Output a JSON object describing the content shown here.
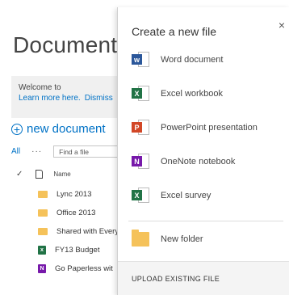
{
  "library": {
    "title": "Documents",
    "welcome_text": "Welcome to",
    "learn_more": "Learn more here.",
    "dismiss": "Dismiss",
    "new_document": "new document",
    "view_all": "All",
    "more": "···",
    "find_placeholder": "Find a file",
    "column_name": "Name",
    "rows": [
      {
        "name": "Lync 2013",
        "icon": "folder-icon"
      },
      {
        "name": "Office 2013",
        "icon": "folder-icon"
      },
      {
        "name": "Shared with Every",
        "icon": "folder-icon"
      },
      {
        "name": "FY13 Budget",
        "icon": "excel-file-icon"
      },
      {
        "name": "Go Paperless wit",
        "icon": "onenote-file-icon"
      }
    ]
  },
  "panel": {
    "title": "Create a new file",
    "close": "×",
    "items": [
      {
        "label": "Word document",
        "icon": "word-icon",
        "letter": "w",
        "color": "#2b579a"
      },
      {
        "label": "Excel workbook",
        "icon": "excel-icon",
        "letter": "X",
        "color": "#217346"
      },
      {
        "label": "PowerPoint presentation",
        "icon": "powerpoint-icon",
        "letter": "P",
        "color": "#d24726"
      },
      {
        "label": "OneNote notebook",
        "icon": "onenote-icon",
        "letter": "N",
        "color": "#7719aa"
      },
      {
        "label": "Excel survey",
        "icon": "excel-survey-icon",
        "letter": "X",
        "color": "#217346"
      }
    ],
    "new_folder": "New folder",
    "upload": "UPLOAD EXISTING FILE"
  },
  "colors": {
    "accent": "#0072c6",
    "folder": "#f5c25a"
  }
}
